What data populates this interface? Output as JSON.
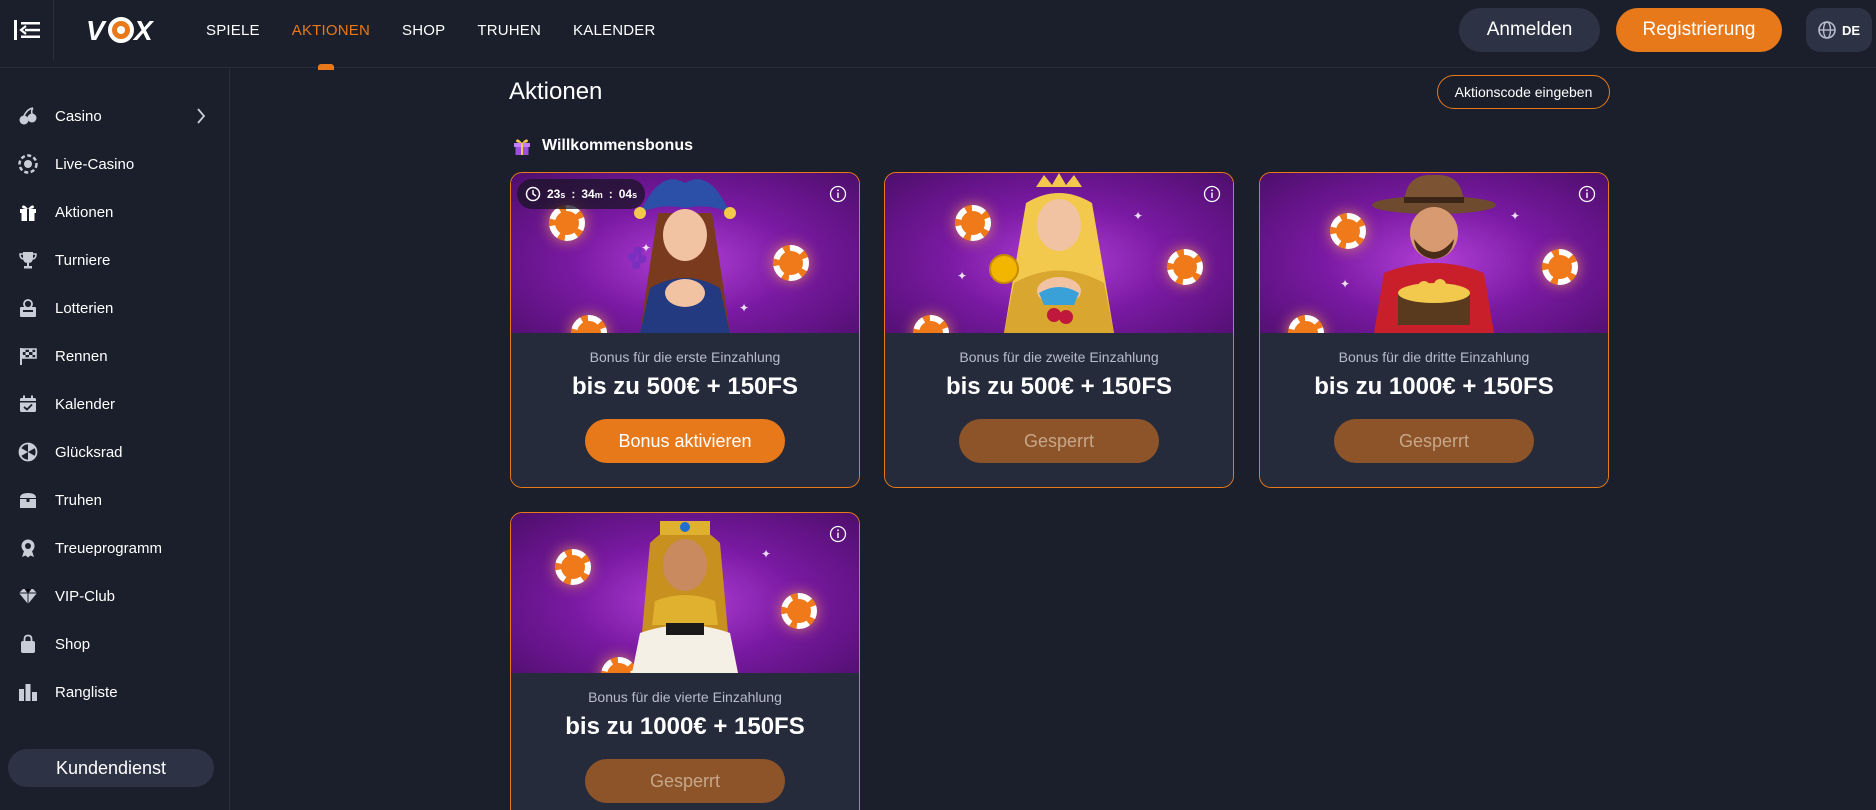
{
  "header": {
    "logo": "VOX",
    "nav": [
      {
        "label": "SPIELE",
        "active": false
      },
      {
        "label": "AKTIONEN",
        "active": true
      },
      {
        "label": "SHOP",
        "active": false
      },
      {
        "label": "TRUHEN",
        "active": false
      },
      {
        "label": "KALENDER",
        "active": false
      }
    ],
    "login_label": "Anmelden",
    "register_label": "Registrierung",
    "language": "DE"
  },
  "sidebar": {
    "items": [
      {
        "label": "Casino",
        "icon": "cherries-icon",
        "has_chevron": true
      },
      {
        "label": "Live-Casino",
        "icon": "chip-icon"
      },
      {
        "label": "Aktionen",
        "icon": "gift-icon"
      },
      {
        "label": "Turniere",
        "icon": "trophy-icon"
      },
      {
        "label": "Lotterien",
        "icon": "lottery-icon"
      },
      {
        "label": "Rennen",
        "icon": "race-flag-icon"
      },
      {
        "label": "Kalender",
        "icon": "calendar-icon"
      },
      {
        "label": "Glücksrad",
        "icon": "wheel-icon"
      },
      {
        "label": "Truhen",
        "icon": "chest-icon"
      },
      {
        "label": "Treueprogramm",
        "icon": "badge-icon"
      },
      {
        "label": "VIP-Club",
        "icon": "diamond-icon"
      },
      {
        "label": "Shop",
        "icon": "bag-icon"
      },
      {
        "label": "Rangliste",
        "icon": "leaderboard-icon"
      }
    ],
    "support_label": "Kundendienst"
  },
  "main": {
    "title": "Aktionen",
    "code_button": "Aktionscode eingeben",
    "section_title": "Willkommensbonus",
    "cards": [
      {
        "subtitle": "Bonus für die erste Einzahlung",
        "amount": "bis zu 500€ + 150FS",
        "button": "Bonus aktivieren",
        "locked": false,
        "timer": {
          "h": "23",
          "h_unit": "s",
          "m": "34",
          "m_unit": "m",
          "s": "04",
          "s_unit": "s"
        }
      },
      {
        "subtitle": "Bonus für die zweite Einzahlung",
        "amount": "bis zu 500€ + 150FS",
        "button": "Gesperrt",
        "locked": true
      },
      {
        "subtitle": "Bonus für die dritte Einzahlung",
        "amount": "bis zu 1000€ + 150FS",
        "button": "Gesperrt",
        "locked": true
      },
      {
        "subtitle": "Bonus für die vierte Einzahlung",
        "amount": "bis zu 1000€ + 150FS",
        "button": "Gesperrt",
        "locked": true
      }
    ]
  },
  "colors": {
    "accent": "#e8791a",
    "bg": "#1b1e2b",
    "card_bg": "#262b3b",
    "button_dark": "#2d3344",
    "locked": "#8c5428"
  }
}
